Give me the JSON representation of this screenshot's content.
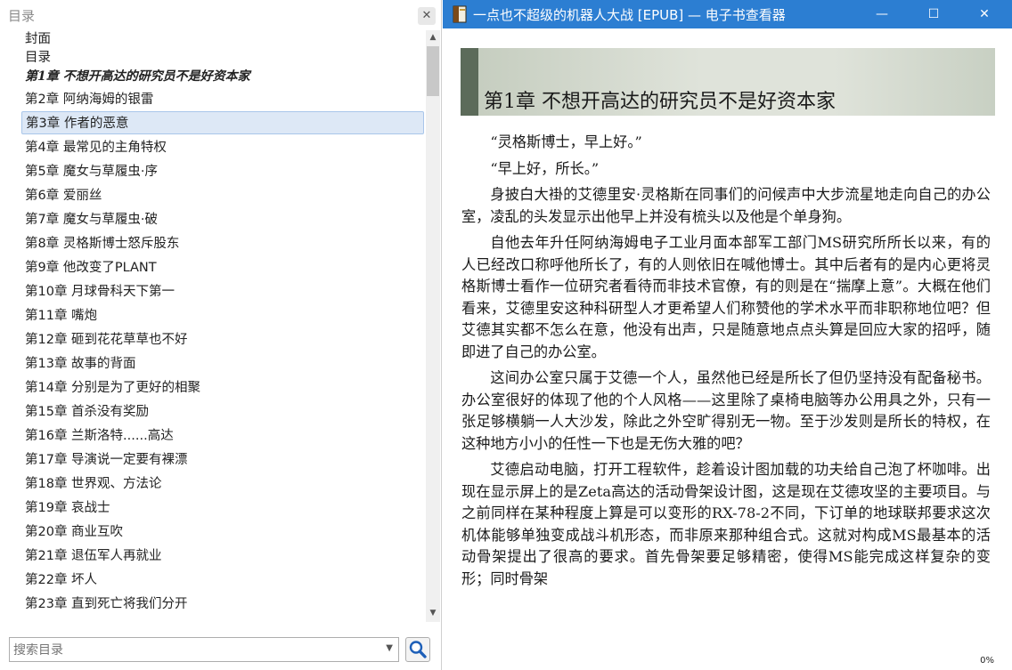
{
  "toc": {
    "title": "目录",
    "close_glyph": "✕",
    "items": [
      {
        "label": "封面"
      },
      {
        "label": "目录"
      },
      {
        "label": "第1章  不想开高达的研究员不是好资本家"
      },
      {
        "label": "第2章 阿纳海姆的银雷"
      },
      {
        "label": "第3章 作者的恶意"
      },
      {
        "label": "第4章 最常见的主角特权"
      },
      {
        "label": "第5章 魔女与草履虫·序"
      },
      {
        "label": "第6章 爱丽丝"
      },
      {
        "label": "第7章 魔女与草履虫·破"
      },
      {
        "label": "第8章 灵格斯博士怒斥股东"
      },
      {
        "label": "第9章 他改变了PLANT"
      },
      {
        "label": "第10章 月球骨科天下第一"
      },
      {
        "label": "第11章 嘴炮"
      },
      {
        "label": "第12章 砸到花花草草也不好"
      },
      {
        "label": "第13章 故事的背面"
      },
      {
        "label": "第14章 分别是为了更好的相聚"
      },
      {
        "label": "第15章 首杀没有奖励"
      },
      {
        "label": "第16章 兰斯洛特......高达"
      },
      {
        "label": "第17章 导演说一定要有裸漂"
      },
      {
        "label": "第18章 世界观、方法论"
      },
      {
        "label": "第19章 哀战士"
      },
      {
        "label": "第20章 商业互吹"
      },
      {
        "label": "第21章 退伍军人再就业"
      },
      {
        "label": "第22章 坏人"
      },
      {
        "label": "第23章 直到死亡将我们分开"
      }
    ],
    "search_placeholder": "搜索目录"
  },
  "viewer": {
    "window_title": "一点也不超级的机器人大战 [EPUB] — 电子书查看器",
    "chapter_title": "第1章 不想开高达的研究员不是好资本家",
    "paragraphs": [
      "“灵格斯博士，早上好。”",
      "“早上好，所长。”",
      "身披白大褂的艾德里安·灵格斯在同事们的问候声中大步流星地走向自己的办公室，凌乱的头发显示出他早上并没有梳头以及他是个单身狗。",
      "自他去年升任阿纳海姆电子工业月面本部军工部门MS研究所所长以来，有的人已经改口称呼他所长了，有的人则依旧在喊他博士。其中后者有的是内心更将灵格斯博士看作一位研究者看待而非技术官僚，有的则是在“揣摩上意”。大概在他们看来，艾德里安这种科研型人才更希望人们称赞他的学术水平而非职称地位吧？但艾德其实都不怎么在意，他没有出声，只是随意地点点头算是回应大家的招呼，随即进了自己的办公室。",
      "这间办公室只属于艾德一个人，虽然他已经是所长了但仍坚持没有配备秘书。办公室很好的体现了他的个人风格——这里除了桌椅电脑等办公用具之外，只有一张足够横躺一人大沙发，除此之外空旷得别无一物。至于沙发则是所长的特权，在这种地方小小的任性一下也是无伤大雅的吧？",
      "艾德启动电脑，打开工程软件，趁着设计图加载的功夫给自己泡了杯咖啡。出现在显示屏上的是Zeta高达的活动骨架设计图，这是现在艾德攻坚的主要项目。与之前同样在某种程度上算是可以变形的RX-78-2不同，下订单的地球联邦要求这次机体能够单独变成战斗机形态，而非原来那种组合式。这就对构成MS最基本的活动骨架提出了很高的要求。首先骨架要足够精密，使得MS能完成这样复杂的变形；同时骨架"
    ],
    "progress": "0%",
    "controls": {
      "minimize": "—",
      "maximize": "☐",
      "close": "✕"
    }
  },
  "colors": {
    "titlebar": "#2c7ed2",
    "selected_bg": "#dde8f6",
    "selected_border": "#a9c6ea",
    "banner_bar": "#5c6b5a"
  }
}
